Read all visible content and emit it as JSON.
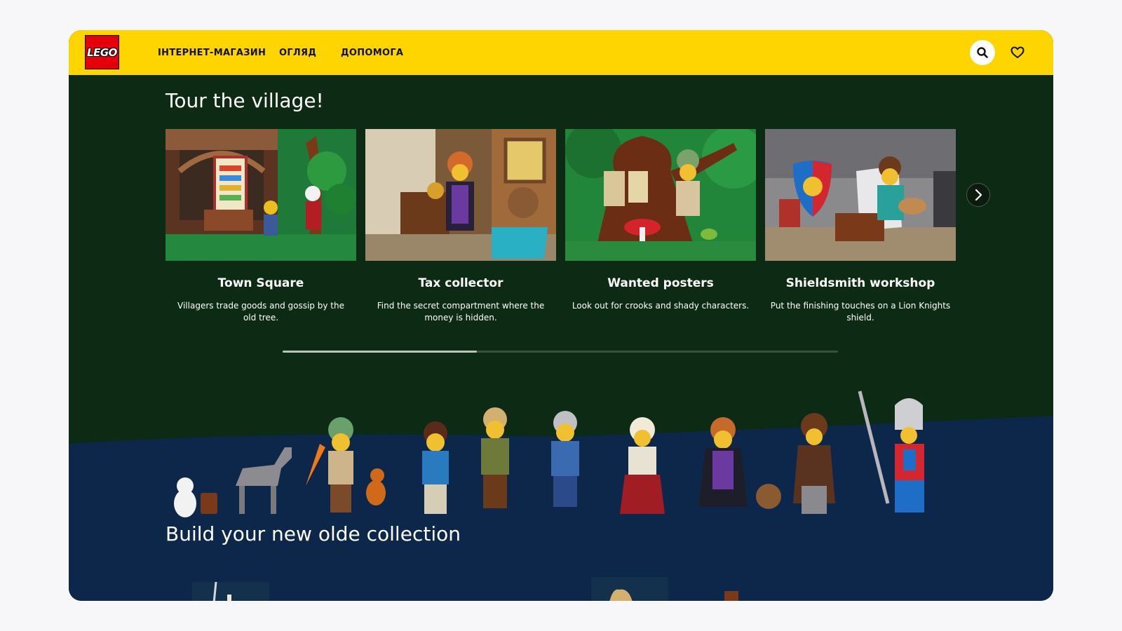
{
  "header": {
    "logo_text": "LEGO",
    "nav": [
      "ІНТЕРНЕТ-МАГАЗИН",
      "ОГЛЯД",
      "ДОПОМОГА"
    ]
  },
  "tour": {
    "title": "Tour the village!",
    "cards": [
      {
        "title": "Town Square",
        "desc": "Villagers trade goods and gossip by the old tree."
      },
      {
        "title": "Tax collector",
        "desc": "Find the secret compartment where the money is hidden."
      },
      {
        "title": "Wanted posters",
        "desc": "Look out for crooks and shady characters."
      },
      {
        "title": "Shieldsmith workshop",
        "desc": "Put the finishing touches on a Lion Knights shield."
      }
    ],
    "scroll_progress": 0.35
  },
  "collection": {
    "title": "Build your new olde collection"
  },
  "colors": {
    "header": "#ffd500",
    "forest": "#0d2a15",
    "navy": "#0c2749",
    "lego_red": "#e3000b"
  },
  "icons": [
    "lego-logo",
    "search-icon",
    "heart-icon",
    "chevron-right-icon"
  ]
}
